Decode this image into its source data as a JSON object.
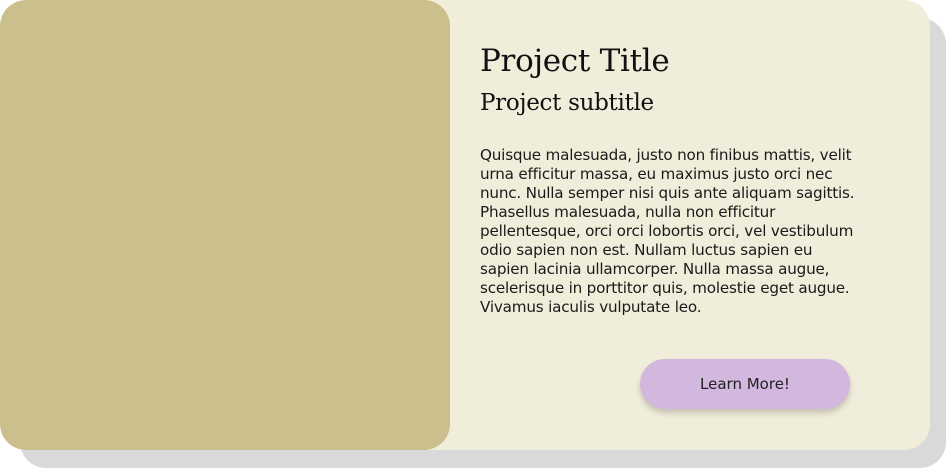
{
  "card": {
    "title": "Project Title",
    "subtitle": "Project subtitle",
    "description": "Quisque malesuada, justo non finibus mattis, velit urna efficitur massa, eu maximus justo orci nec nunc. Nulla semper nisi quis ante aliquam sagittis. Phasellus malesuada, nulla non efficitur pellentesque, orci orci lobortis orci, vel vestibulum odio sapien non est. Nullam luctus sapien eu sapien lacinia ullamcorper. Nulla massa augue, scelerisque in porttitor quis, molestie eget augue. Vivamus iaculis vulputate leo.",
    "button_label": "Learn More!"
  },
  "colors": {
    "card_background": "#f1eddb",
    "image_placeholder": "#cbc08d",
    "button_background": "#d2b7de",
    "shadow": "#d9d9d9"
  }
}
